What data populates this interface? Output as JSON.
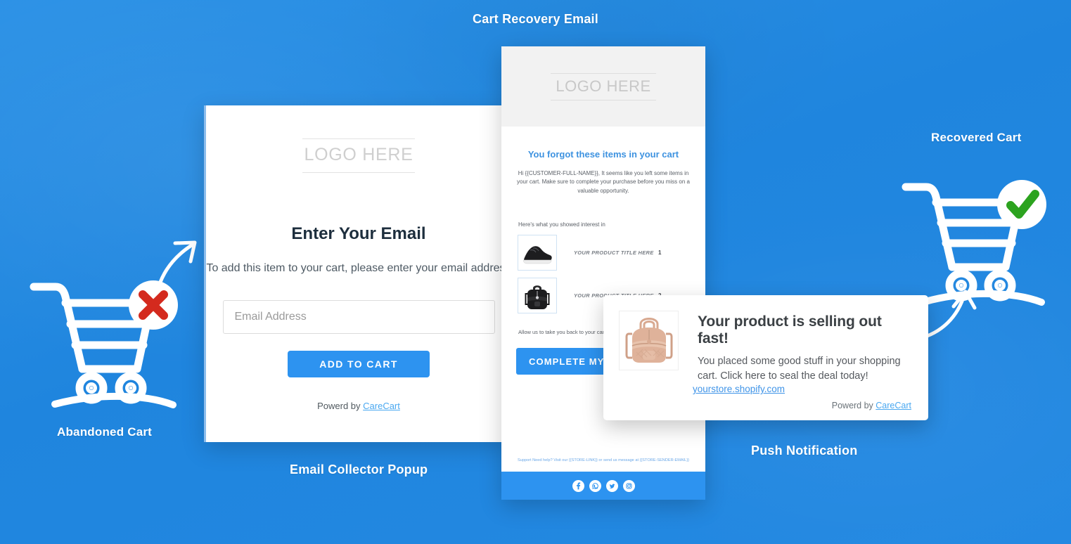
{
  "stage": {
    "background_color": "#2287e0",
    "accent_color": "#2d93f0",
    "labels": {
      "cart_recovery_email": "Cart Recovery Email",
      "recovered_cart": "Recovered Cart",
      "abandoned_cart": "Abandoned Cart",
      "email_collector_popup": "Email Collector Popup",
      "push_notification": "Push Notification"
    }
  },
  "abandoned_cart_art": {
    "icon": "shopping-cart-icon",
    "badge_icon": "red-cross-icon",
    "badge_color": "#d42a1e",
    "arrow_icon": "curved-arrow-up-right-icon"
  },
  "recovered_cart_art": {
    "icon": "shopping-cart-icon",
    "badge_icon": "green-check-icon",
    "badge_color": "#2ca31f",
    "arrow_icon": "curved-arrow-up-icon"
  },
  "email_collector_popup": {
    "logo_placeholder": "LOGO HERE",
    "title": "Enter Your Email",
    "subtitle": "To add this item to your cart, please enter your email address",
    "email_placeholder": "Email Address",
    "email_value": "",
    "cta_label": "ADD TO CART",
    "powered_prefix": "Powerd by ",
    "powered_brand": "CareCart"
  },
  "cart_recovery_email": {
    "logo_placeholder": "LOGO HERE",
    "heading": "You forgot these items in your cart",
    "body": "Hi {{CUSTOMER-FULL-NAME}}, It seems like you left some items in your cart. Make sure to complete your purchase before you miss on a valuable opportunity.",
    "section_label": "Here's what you showed interest in",
    "products": [
      {
        "image": "black-sneaker-icon",
        "title": "YOUR PRODUCT TITLE HERE",
        "qty": "1"
      },
      {
        "image": "black-backpack-icon",
        "title": "YOUR PRODUCT TITLE HERE",
        "qty": "2"
      }
    ],
    "closing_text": "Allow us to take you back to your cart",
    "cta_label": "COMPLETE MY PURCHASE",
    "support_text": "Support Need help? Visit our {{STORE-LINK}} or send us message at {{STORE-SENDER-EMAIL}}",
    "social_icons": [
      "facebook-icon",
      "whatsapp-icon",
      "twitter-icon",
      "instagram-icon"
    ]
  },
  "push_notification": {
    "image": "pink-backpack-icon",
    "title": "Your product is selling out fast!",
    "body": "You placed some good stuff in your shopping cart. Click here to seal the deal today!",
    "url": "yourstore.shopify.com",
    "powered_prefix": "Powerd by ",
    "powered_brand": "CareCart"
  }
}
